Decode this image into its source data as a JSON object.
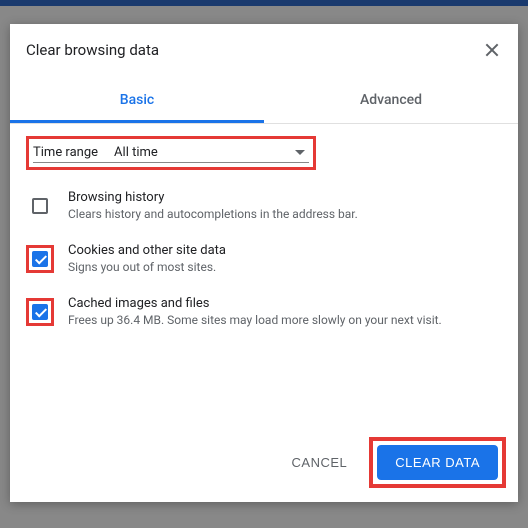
{
  "dialog": {
    "title": "Clear browsing data"
  },
  "tabs": {
    "basic": "Basic",
    "advanced": "Advanced"
  },
  "timeRange": {
    "label": "Time range",
    "value": "All time"
  },
  "options": [
    {
      "title": "Browsing history",
      "desc": "Clears history and autocompletions in the address bar.",
      "checked": false,
      "highlighted": false
    },
    {
      "title": "Cookies and other site data",
      "desc": "Signs you out of most sites.",
      "checked": true,
      "highlighted": true
    },
    {
      "title": "Cached images and files",
      "desc": "Frees up 36.4 MB. Some sites may load more slowly on your next visit.",
      "checked": true,
      "highlighted": true
    }
  ],
  "footer": {
    "cancel": "CANCEL",
    "clear": "CLEAR DATA"
  }
}
